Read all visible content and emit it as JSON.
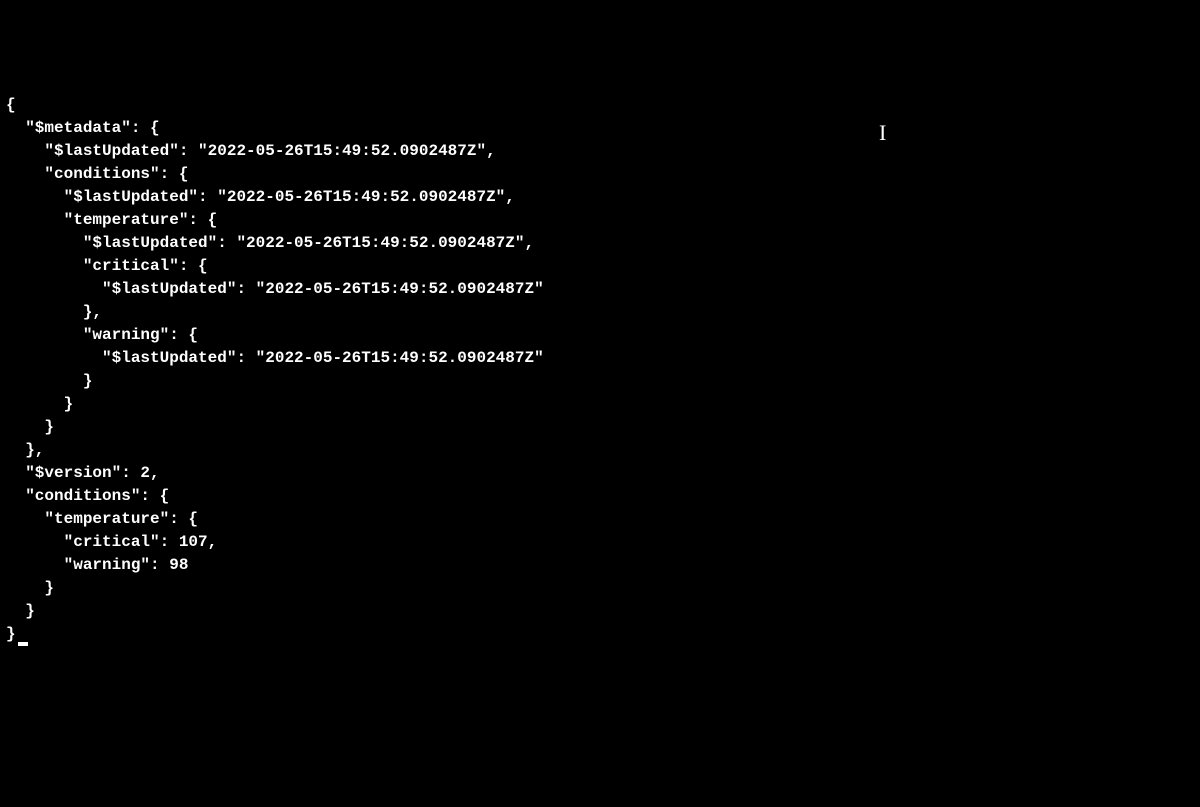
{
  "code": {
    "line1": "{",
    "line2": "  \"$metadata\": {",
    "line3": "    \"$lastUpdated\": \"2022-05-26T15:49:52.0902487Z\",",
    "line4": "    \"conditions\": {",
    "line5": "      \"$lastUpdated\": \"2022-05-26T15:49:52.0902487Z\",",
    "line6": "      \"temperature\": {",
    "line7": "        \"$lastUpdated\": \"2022-05-26T15:49:52.0902487Z\",",
    "line8": "        \"critical\": {",
    "line9": "          \"$lastUpdated\": \"2022-05-26T15:49:52.0902487Z\"",
    "line10": "        },",
    "line11": "        \"warning\": {",
    "line12": "          \"$lastUpdated\": \"2022-05-26T15:49:52.0902487Z\"",
    "line13": "        }",
    "line14": "      }",
    "line15": "    }",
    "line16": "  },",
    "line17": "  \"$version\": 2,",
    "line18": "  \"conditions\": {",
    "line19": "    \"temperature\": {",
    "line20": "      \"critical\": 107,",
    "line21": "      \"warning\": 98",
    "line22": "    }",
    "line23": "  }",
    "line24": "}"
  },
  "cursor": "I"
}
